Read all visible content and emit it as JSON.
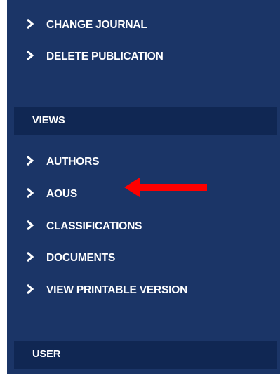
{
  "sidebar": {
    "top_items": [
      {
        "label": "CHANGE JOURNAL",
        "icon": "chevron-right-icon"
      },
      {
        "label": "DELETE PUBLICATION",
        "icon": "chevron-right-icon"
      }
    ],
    "views_section": {
      "header": "VIEWS",
      "items": [
        {
          "label": "AUTHORS",
          "icon": "chevron-right-icon"
        },
        {
          "label": "AOUS",
          "icon": "chevron-right-icon"
        },
        {
          "label": "CLASSIFICATIONS",
          "icon": "chevron-right-icon"
        },
        {
          "label": "DOCUMENTS",
          "icon": "chevron-right-icon"
        },
        {
          "label": "VIEW PRINTABLE VERSION",
          "icon": "chevron-right-icon"
        }
      ]
    },
    "user_section": {
      "header": "USER"
    }
  },
  "annotation": {
    "icon": "red-arrow-pointing-left",
    "target": "AOUS",
    "color": "#ff0000"
  },
  "colors": {
    "sidebar_bg": "#1b3567",
    "section_header_bg": "#102753",
    "text": "#ffffff"
  }
}
